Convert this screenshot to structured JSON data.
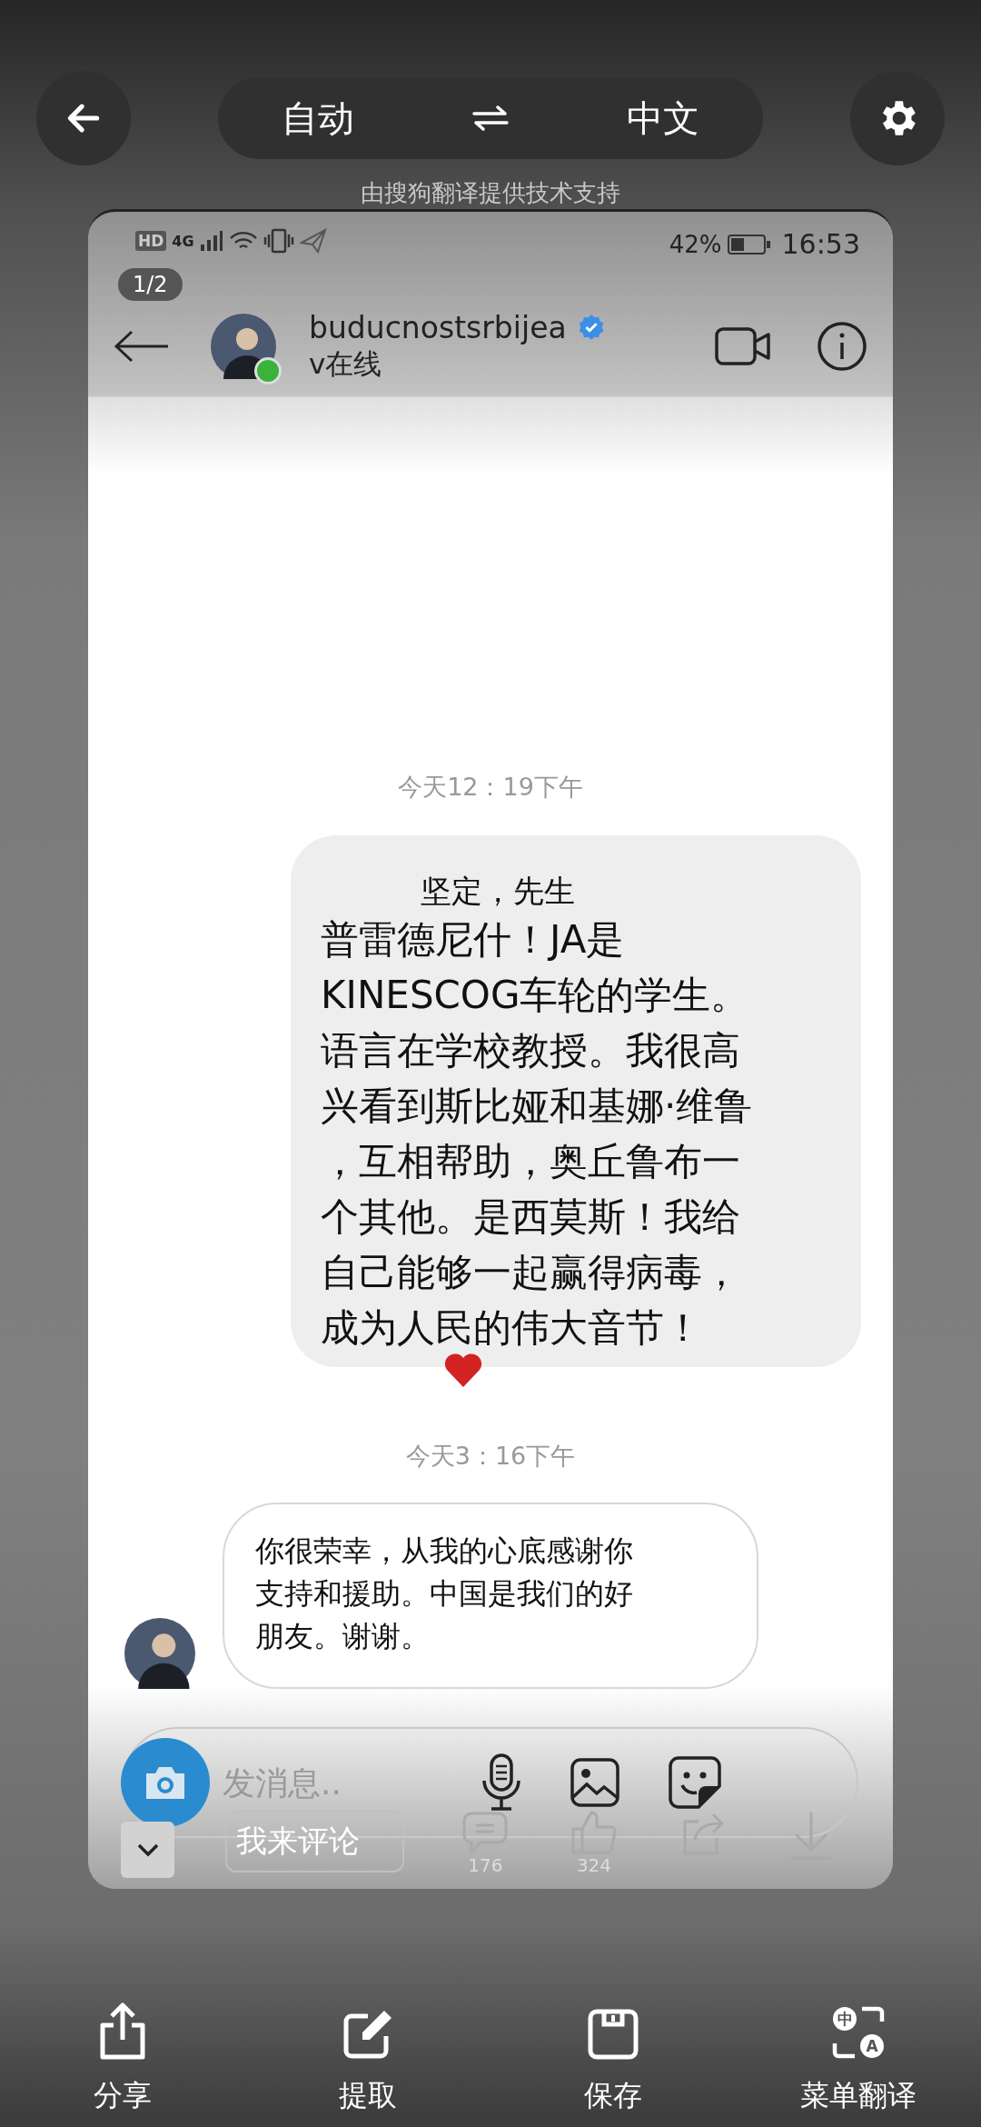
{
  "top_bar": {
    "source_language": "自动",
    "target_language": "中文",
    "powered_by": "由搜狗翻译提供技术支持"
  },
  "page_indicator": "1/2",
  "screenshot": {
    "status_bar": {
      "hd_label": "HD",
      "network_label": "4G",
      "battery_percent": "42%",
      "time": "16:53"
    },
    "chat_header": {
      "username": "buducnostsrbijea",
      "verified": true,
      "online": true,
      "status": "v在线"
    },
    "messages": [
      {
        "kind": "timestamp",
        "text": "今天12：19下午"
      },
      {
        "kind": "outgoing",
        "salutation": "坚定，先生",
        "lines": [
          "普雷德尼什！JA是",
          "KINESCOG车轮的学生。",
          "语言在学校教授。我很高",
          "兴看到斯比娅和基娜·维鲁",
          "，互相帮助，奥丘鲁布一",
          "个其他。是西莫斯！我给",
          "自己能够一起赢得病毒，",
          "成为人民的伟大音节！"
        ],
        "liked": true
      },
      {
        "kind": "timestamp",
        "text": "今天3：16下午"
      },
      {
        "kind": "incoming",
        "lines": [
          "你很荣幸，从我的心底感谢你",
          "支持和援助。中国是我们的好",
          "朋友。谢谢。"
        ]
      }
    ],
    "composer": {
      "placeholder": "发消息.."
    },
    "comment_bar": {
      "comment_placeholder": "我来评论",
      "comment_count": "176",
      "like_count": "324"
    }
  },
  "bottom_toolbar": [
    {
      "kind": "share",
      "label": "分享"
    },
    {
      "kind": "edit",
      "label": "提取"
    },
    {
      "kind": "save",
      "label": "保存"
    },
    {
      "kind": "menu-translate",
      "label": "菜单翻译",
      "badge_top": "中",
      "badge_bottom": "A"
    }
  ]
}
